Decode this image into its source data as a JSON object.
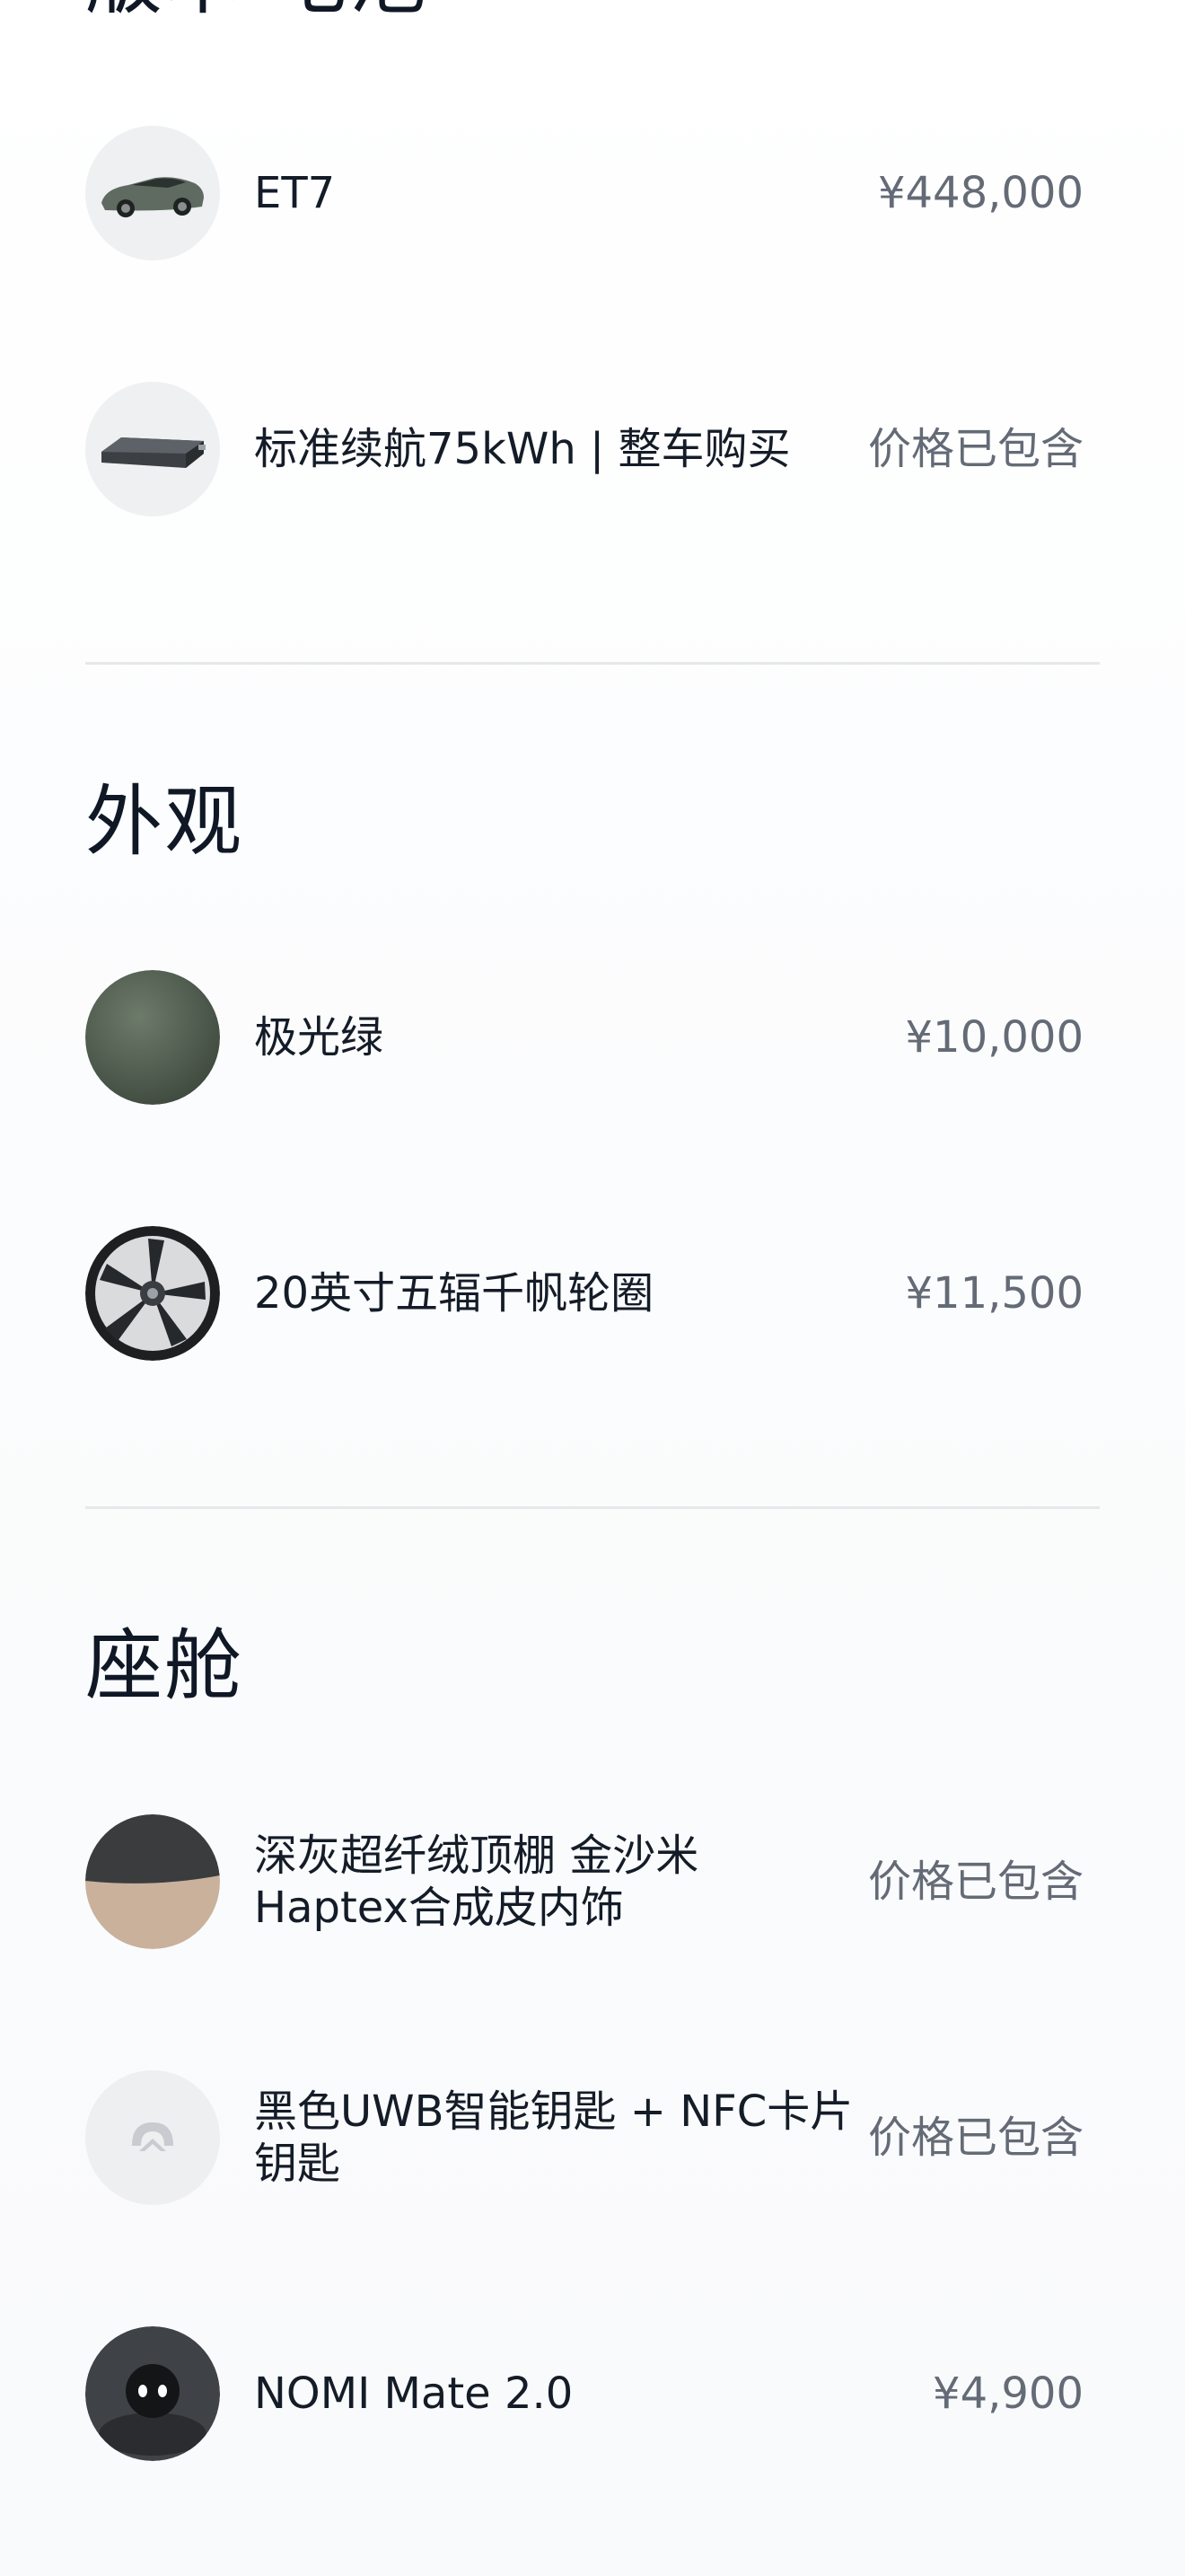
{
  "sections": [
    {
      "title": "版本·电池",
      "items": [
        {
          "name": "ET7",
          "price": "¥448,000",
          "icon": "car-thumbnail"
        },
        {
          "name": "标准续航75kWh | 整车购买",
          "price": "价格已包含",
          "icon": "battery-thumbnail"
        }
      ]
    },
    {
      "title": "外观",
      "items": [
        {
          "name": "极光绿",
          "price": "¥10,000",
          "icon": "color-swatch-green"
        },
        {
          "name": "20英寸五辐千帆轮圈",
          "price": "¥11,500",
          "icon": "wheel-thumbnail"
        }
      ]
    },
    {
      "title": "座舱",
      "items": [
        {
          "name": "深灰超纤绒顶棚 金沙米 Haptex合成皮内饰",
          "price": "价格已包含",
          "icon": "interior-swatch"
        },
        {
          "name": "黑色UWB智能钥匙 + NFC卡片钥匙",
          "price": "价格已包含",
          "icon": "nio-key-logo"
        },
        {
          "name": "NOMI Mate 2.0",
          "price": "¥4,900",
          "icon": "nomi-thumbnail"
        }
      ]
    }
  ],
  "colors": {
    "swatch_green": "#4e5c4c",
    "divider": "#e6e8eb",
    "price_text": "#646b76"
  }
}
